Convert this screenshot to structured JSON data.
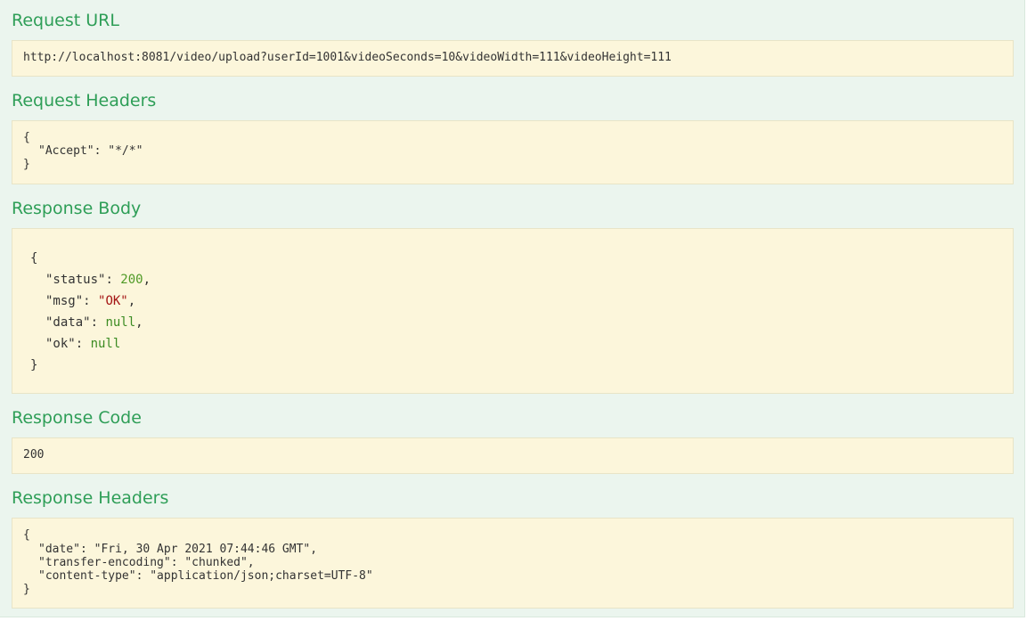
{
  "request_url": {
    "title": "Request URL",
    "value": "http://localhost:8081/video/upload?userId=1001&videoSeconds=10&videoWidth=111&videoHeight=111"
  },
  "request_headers": {
    "title": "Request Headers",
    "open": "{",
    "lines": [
      "\"Accept\": \"*/*\""
    ],
    "close": "}"
  },
  "response_body": {
    "title": "Response Body",
    "open": "{",
    "close": "}",
    "fields": [
      {
        "key": "\"status\"",
        "value": "200",
        "suffix": ","
      },
      {
        "key": "\"msg\"",
        "value": "\"OK\"",
        "suffix": ","
      },
      {
        "key": "\"data\"",
        "value": "null",
        "suffix": ","
      },
      {
        "key": "\"ok\"",
        "value": "null",
        "suffix": ""
      }
    ]
  },
  "response_code": {
    "title": "Response Code",
    "value": "200"
  },
  "response_headers": {
    "title": "Response Headers",
    "open": "{",
    "lines": [
      "\"date\": \"Fri, 30 Apr 2021 07:44:46 GMT\",",
      "\"transfer-encoding\": \"chunked\",",
      "\"content-type\": \"application/json;charset=UTF-8\""
    ],
    "close": "}"
  },
  "colors": {
    "panel_background": "#ebf5ee",
    "title_green": "#2e9e57",
    "block_background": "#fcf6db",
    "json_number": "#4f9a26",
    "json_string": "#a41414",
    "json_null": "#3b8b22"
  }
}
